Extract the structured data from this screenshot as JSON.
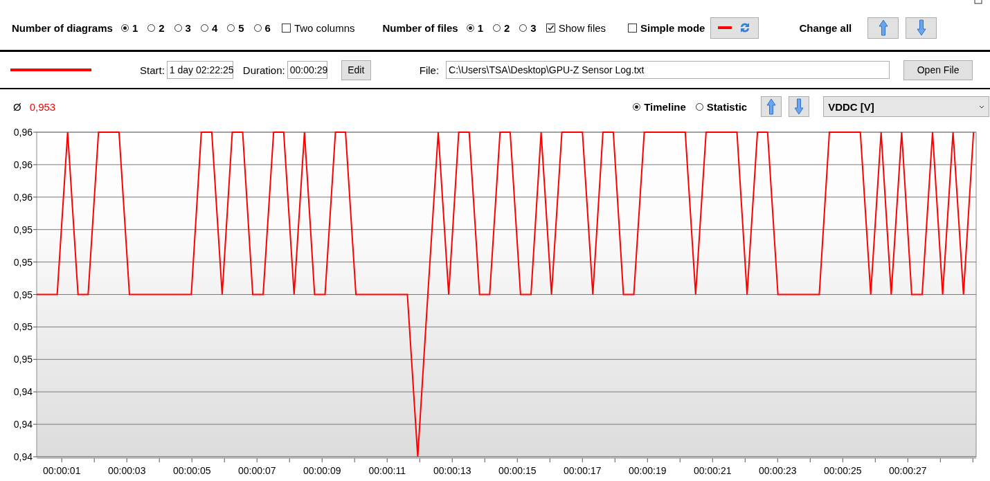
{
  "toolbar": {
    "diagrams_label": "Number of diagrams",
    "diagram_options": [
      {
        "label": "1",
        "selected": true
      },
      {
        "label": "2",
        "selected": false
      },
      {
        "label": "3",
        "selected": false
      },
      {
        "label": "4",
        "selected": false
      },
      {
        "label": "5",
        "selected": false
      },
      {
        "label": "6",
        "selected": false
      }
    ],
    "two_columns": {
      "label": "Two columns",
      "checked": false
    },
    "files_label": "Number of files",
    "file_options": [
      {
        "label": "1",
        "selected": true
      },
      {
        "label": "2",
        "selected": false
      },
      {
        "label": "3",
        "selected": false
      }
    ],
    "show_files": {
      "label": "Show files",
      "checked": true
    },
    "simple_mode": {
      "label": "Simple mode",
      "checked": false
    },
    "change_all_label": "Change all"
  },
  "file_row": {
    "start_label": "Start:",
    "start": "1 day 02:22:25",
    "duration_label": "Duration:",
    "duration": "00:00:29",
    "edit_button": "Edit",
    "file_label": "File:",
    "file": "C:\\Users\\TSA\\Desktop\\GPU-Z Sensor Log.txt",
    "open_button": "Open File"
  },
  "diagram": {
    "average_symbol": "Ø",
    "average": "0,953",
    "views": [
      {
        "label": "Timeline",
        "selected": true
      },
      {
        "label": "Statistic",
        "selected": false
      }
    ],
    "channel": "VDDC [V]",
    "chart_data": {
      "type": "line",
      "x": [
        0.23,
        0.55,
        0.86,
        1.18,
        1.5,
        1.81,
        2.13,
        2.44,
        2.76,
        3.08,
        3.39,
        3.71,
        4.03,
        4.34,
        4.66,
        4.98,
        5.29,
        5.61,
        5.93,
        6.24,
        6.56,
        6.87,
        7.19,
        7.51,
        7.82,
        8.14,
        8.46,
        8.77,
        9.09,
        9.41,
        9.72,
        10.04,
        10.35,
        10.67,
        10.99,
        11.3,
        11.62,
        11.94,
        12.25,
        12.57,
        12.89,
        13.2,
        13.52,
        13.84,
        14.15,
        14.47,
        14.78,
        15.1,
        15.42,
        15.73,
        16.05,
        16.37,
        16.68,
        17.0,
        17.32,
        17.63,
        17.95,
        18.26,
        18.58,
        18.9,
        19.21,
        19.53,
        19.85,
        20.16,
        20.48,
        20.8,
        21.11,
        21.43,
        21.75,
        22.06,
        22.38,
        22.69,
        23.01,
        23.33,
        23.64,
        23.96,
        24.28,
        24.59,
        24.91,
        25.23,
        25.54,
        25.86,
        26.18,
        26.49,
        26.81,
        27.12,
        27.44,
        27.76,
        28.07,
        28.39,
        28.71,
        29.02
      ],
      "series": [
        {
          "color": "#ff0000",
          "values": [
            0.95,
            0.95,
            0.95,
            0.96,
            0.95,
            0.95,
            0.96,
            0.96,
            0.96,
            0.95,
            0.95,
            0.95,
            0.95,
            0.95,
            0.95,
            0.95,
            0.96,
            0.96,
            0.95,
            0.96,
            0.96,
            0.95,
            0.95,
            0.96,
            0.96,
            0.95,
            0.96,
            0.95,
            0.95,
            0.96,
            0.96,
            0.95,
            0.95,
            0.95,
            0.95,
            0.95,
            0.95,
            0.94,
            0.95,
            0.96,
            0.95,
            0.96,
            0.96,
            0.95,
            0.95,
            0.96,
            0.96,
            0.95,
            0.95,
            0.96,
            0.95,
            0.96,
            0.96,
            0.96,
            0.95,
            0.96,
            0.96,
            0.95,
            0.95,
            0.96,
            0.96,
            0.96,
            0.96,
            0.96,
            0.95,
            0.96,
            0.96,
            0.96,
            0.96,
            0.95,
            0.96,
            0.96,
            0.95,
            0.95,
            0.95,
            0.95,
            0.95,
            0.96,
            0.96,
            0.96,
            0.96,
            0.95,
            0.96,
            0.95,
            0.96,
            0.95,
            0.95,
            0.96,
            0.95,
            0.96,
            0.95,
            0.96
          ]
        }
      ],
      "grid": true,
      "xlim": [
        0.23,
        29.1
      ],
      "ylim": [
        0.94,
        0.96
      ],
      "xticks": [
        {
          "value": 1,
          "label": "00:00:01"
        },
        {
          "value": 3,
          "label": "00:00:03"
        },
        {
          "value": 5,
          "label": "00:00:05"
        },
        {
          "value": 7,
          "label": "00:00:07"
        },
        {
          "value": 9,
          "label": "00:00:09"
        },
        {
          "value": 11,
          "label": "00:00:11"
        },
        {
          "value": 13,
          "label": "00:00:13"
        },
        {
          "value": 15,
          "label": "00:00:15"
        },
        {
          "value": 17,
          "label": "00:00:17"
        },
        {
          "value": 19,
          "label": "00:00:19"
        },
        {
          "value": 21,
          "label": "00:00:21"
        },
        {
          "value": 23,
          "label": "00:00:23"
        },
        {
          "value": 25,
          "label": "00:00:25"
        },
        {
          "value": 27,
          "label": "00:00:27"
        }
      ],
      "yticks": [
        {
          "value": 0.96,
          "label": "0,96"
        },
        {
          "value": 0.958,
          "label": "0,96"
        },
        {
          "value": 0.956,
          "label": "0,96"
        },
        {
          "value": 0.954,
          "label": "0,95"
        },
        {
          "value": 0.952,
          "label": "0,95"
        },
        {
          "value": 0.95,
          "label": "0,95"
        },
        {
          "value": 0.948,
          "label": "0,95"
        },
        {
          "value": 0.946,
          "label": "0,95"
        },
        {
          "value": 0.944,
          "label": "0,94"
        },
        {
          "value": 0.942,
          "label": "0,94"
        },
        {
          "value": 0.94,
          "label": "0,94"
        }
      ]
    }
  }
}
